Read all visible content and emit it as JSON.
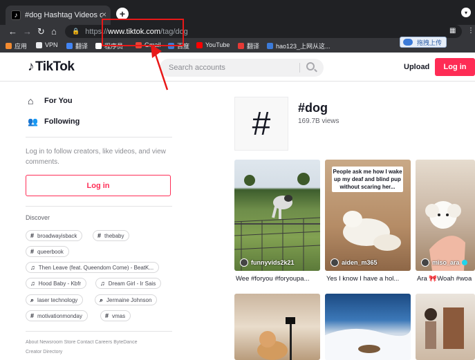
{
  "browser": {
    "tab_title": "#dog Hashtag Videos on TikTok",
    "tab_close": "×",
    "new_tab": "+",
    "url_prefix": "https://",
    "url_host": "www.tiktok.com",
    "url_path": "/tag/dog"
  },
  "bookmarks": [
    {
      "label": "应用",
      "color": "#f28b30"
    },
    {
      "label": "VPN",
      "color": "#e8eaed"
    },
    {
      "label": "翻译",
      "color": "#4285f4"
    },
    {
      "label": "程序员",
      "color": "#fff"
    },
    {
      "label": "Gmail",
      "color": "#ea4335"
    },
    {
      "label": "百度",
      "color": "#3c7bd9"
    },
    {
      "label": "YouTube",
      "color": "#ff0000"
    },
    {
      "label": "翻译",
      "color": "#e53935"
    },
    {
      "label": "hao123_上网从这...",
      "color": "#3c7bd9"
    }
  ],
  "upload_widget": "拖拽上传",
  "header": {
    "logo": "TikTok",
    "search_placeholder": "Search accounts",
    "upload": "Upload",
    "login": "Log in"
  },
  "sidebar": {
    "nav": [
      {
        "label": "For You",
        "icon": "home-icon"
      },
      {
        "label": "Following",
        "icon": "people-icon"
      }
    ],
    "login_prompt": "Log in to follow creators, like videos, and view comments.",
    "login_button": "Log in",
    "discover_title": "Discover",
    "chips": [
      {
        "icon": "#",
        "label": "broadwayisback"
      },
      {
        "icon": "#",
        "label": "thebaby"
      },
      {
        "icon": "#",
        "label": "queerbook"
      },
      {
        "icon": "♫",
        "label": "Then Leave (feat. Queendom Come) - BeatK..."
      },
      {
        "icon": "♫",
        "label": "Hood Baby - Kbfr"
      },
      {
        "icon": "♫",
        "label": "Dream Girl - Ir Sais"
      },
      {
        "icon": "⌕",
        "label": "laser technology"
      },
      {
        "icon": "⌕",
        "label": "Jermaine Johnson"
      },
      {
        "icon": "#",
        "label": "motivationmonday"
      },
      {
        "icon": "#",
        "label": "vmas"
      }
    ],
    "footer_line1": "About  Newsroom  Store  Contact  Careers  ByteDance",
    "footer_line2": "Creator Directory"
  },
  "tag": {
    "symbol": "#",
    "title": "#dog",
    "views": "169.7B views"
  },
  "videos": [
    {
      "author": "funnyvids2k21",
      "caption": "Wee #foryou #foryoupa...",
      "overlay": ""
    },
    {
      "author": "aiden_m365",
      "caption": "Yes I know I have a hol...",
      "overlay": "People ask me how I wake up my deaf and blind pup without scaring her..."
    },
    {
      "author": "miso_ara",
      "caption": "Ara 🎀Woah #woa",
      "overlay": ""
    }
  ]
}
